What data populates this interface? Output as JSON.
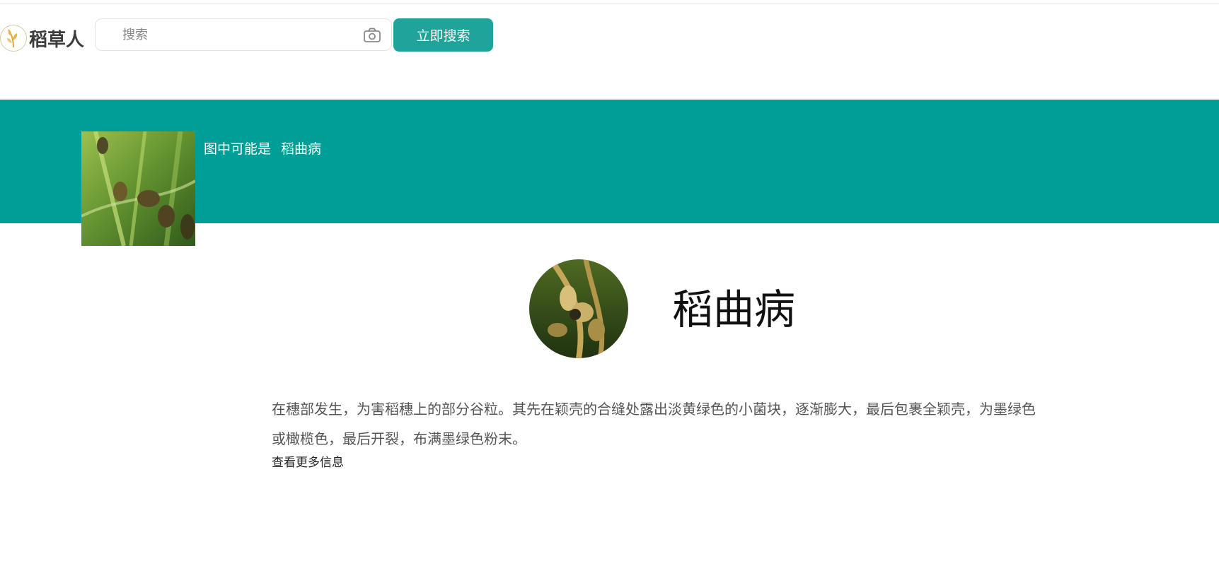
{
  "header": {
    "logo_text": "稻草人",
    "search": {
      "placeholder": "搜索",
      "value": "",
      "button_label": "立即搜索"
    }
  },
  "banner": {
    "prefix": "图中可能是",
    "result": "稻曲病"
  },
  "detail": {
    "title": "稻曲病",
    "description": "在穗部发生，为害稻穗上的部分谷粒。其先在颖壳的合缝处露出淡黄绿色的小菌块，逐渐膨大，最后包裹全颖壳，为墨绿色或橄榄色，最后开裂，布满墨绿色粉末。",
    "more_link": "查看更多信息"
  },
  "colors": {
    "accent": "#1fa39a",
    "banner": "#009e96"
  },
  "icons": {
    "logo": "rice-stalk-logo-icon",
    "camera": "camera-icon"
  }
}
